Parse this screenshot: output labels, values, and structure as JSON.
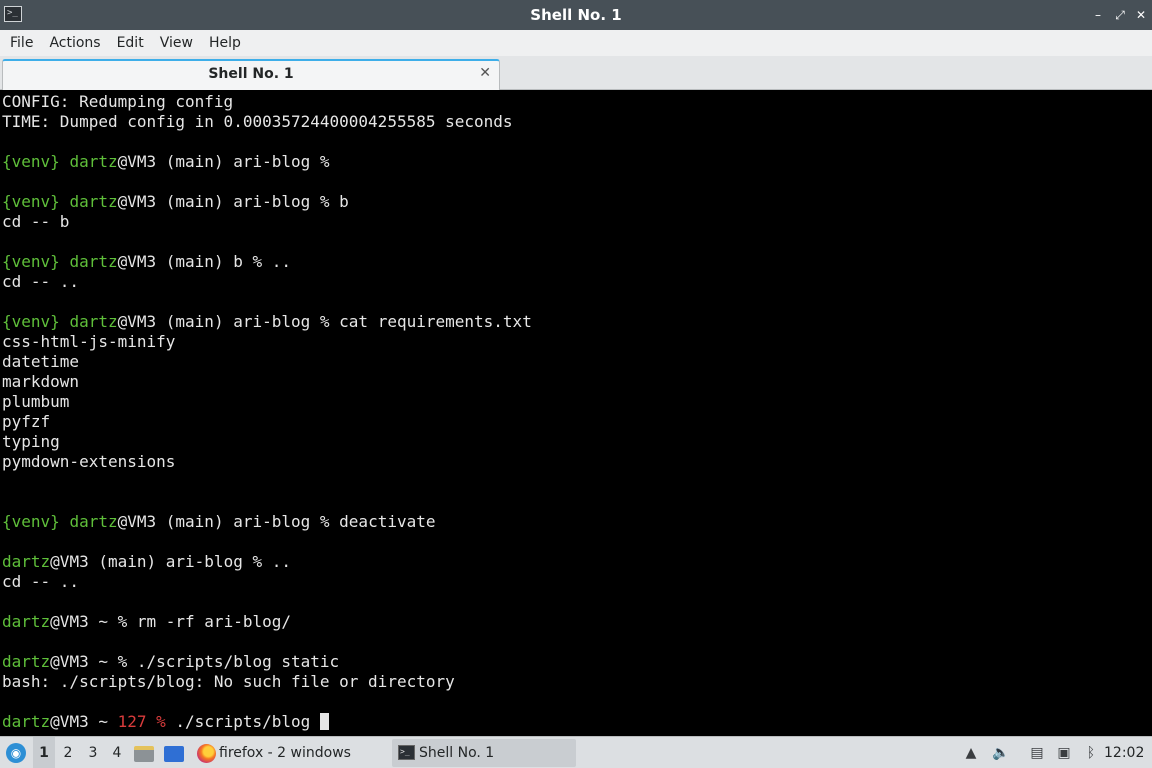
{
  "window": {
    "title": "Shell No. 1",
    "controls": {
      "minimize": "–",
      "maximize": "⤢",
      "close": "✕"
    }
  },
  "menubar": [
    "File",
    "Actions",
    "Edit",
    "View",
    "Help"
  ],
  "tab": {
    "label": "Shell No. 1",
    "close": "✕"
  },
  "terminal": {
    "colors": {
      "background": "#000000",
      "foreground": "#e6e6e6",
      "green": "#5fbf3a",
      "red": "#d93c3c"
    },
    "lines": [
      [
        {
          "t": "CONFIG: Redumping config"
        }
      ],
      [
        {
          "t": "TIME: Dumped config in 0.00035724400004255585 seconds"
        }
      ],
      [],
      [
        {
          "t": "{venv}",
          "c": "g"
        },
        {
          "t": " "
        },
        {
          "t": "dartz",
          "c": "g"
        },
        {
          "t": "@VM3 (main) ari-blog %"
        }
      ],
      [],
      [
        {
          "t": "{venv}",
          "c": "g"
        },
        {
          "t": " "
        },
        {
          "t": "dartz",
          "c": "g"
        },
        {
          "t": "@VM3 (main) ari-blog % b"
        }
      ],
      [
        {
          "t": "cd -- b"
        }
      ],
      [],
      [
        {
          "t": "{venv}",
          "c": "g"
        },
        {
          "t": " "
        },
        {
          "t": "dartz",
          "c": "g"
        },
        {
          "t": "@VM3 (main) b % .."
        }
      ],
      [
        {
          "t": "cd -- .."
        }
      ],
      [],
      [
        {
          "t": "{venv}",
          "c": "g"
        },
        {
          "t": " "
        },
        {
          "t": "dartz",
          "c": "g"
        },
        {
          "t": "@VM3 (main) ari-blog % cat requirements.txt"
        }
      ],
      [
        {
          "t": "css-html-js-minify"
        }
      ],
      [
        {
          "t": "datetime"
        }
      ],
      [
        {
          "t": "markdown"
        }
      ],
      [
        {
          "t": "plumbum"
        }
      ],
      [
        {
          "t": "pyfzf"
        }
      ],
      [
        {
          "t": "typing"
        }
      ],
      [
        {
          "t": "pymdown-extensions"
        }
      ],
      [],
      [],
      [
        {
          "t": "{venv}",
          "c": "g"
        },
        {
          "t": " "
        },
        {
          "t": "dartz",
          "c": "g"
        },
        {
          "t": "@VM3 (main) ari-blog % deactivate"
        }
      ],
      [],
      [
        {
          "t": "dartz",
          "c": "g"
        },
        {
          "t": "@VM3 (main) ari-blog % .."
        }
      ],
      [
        {
          "t": "cd -- .."
        }
      ],
      [],
      [
        {
          "t": "dartz",
          "c": "g"
        },
        {
          "t": "@VM3 ~ % rm -rf ari-blog/"
        }
      ],
      [],
      [
        {
          "t": "dartz",
          "c": "g"
        },
        {
          "t": "@VM3 ~ % ./scripts/blog static"
        }
      ],
      [
        {
          "t": "bash: ./scripts/blog: No such file or directory"
        }
      ],
      [],
      [
        {
          "t": "dartz",
          "c": "g"
        },
        {
          "t": "@VM3 ~ "
        },
        {
          "t": "127 %",
          "c": "r"
        },
        {
          "t": " ./scripts/blog "
        },
        {
          "cursor": true
        }
      ]
    ]
  },
  "taskbar": {
    "start_icon": "start-menu-icon",
    "desktops": [
      "1",
      "2",
      "3",
      "4"
    ],
    "active_desktop": "1",
    "launchers": [
      "file-manager-icon",
      "show-desktop-icon"
    ],
    "firefox_task": "firefox - 2 windows",
    "shell_task": "Shell No. 1",
    "tray": [
      "update-icon",
      "volume-icon",
      "clipboard-icon",
      "network-icon",
      "bluetooth-icon"
    ],
    "clock": "12:02"
  }
}
